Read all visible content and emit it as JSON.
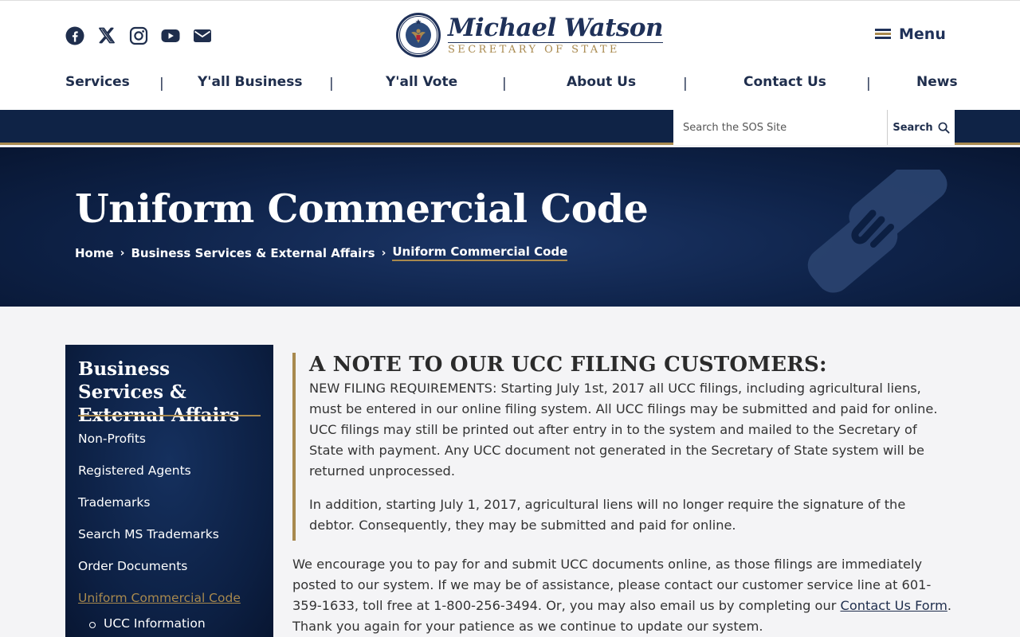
{
  "header": {
    "social_icons": [
      "facebook-icon",
      "x-twitter-icon",
      "instagram-icon",
      "youtube-icon",
      "email-icon"
    ],
    "logo_name": "Michael Watson",
    "logo_subtitle": "SECRETARY OF STATE",
    "menu_label": "Menu"
  },
  "nav": {
    "items": [
      "Services",
      "Y'all Business",
      "Y'all Vote",
      "About Us",
      "Contact Us",
      "News"
    ],
    "separator": "|"
  },
  "search": {
    "placeholder": "Search the SOS Site",
    "button_label": "Search"
  },
  "hero": {
    "title": "Uniform Commercial Code",
    "breadcrumbs": [
      "Home",
      "Business Services & External Affairs",
      "Uniform Commercial Code"
    ],
    "arrow": "›"
  },
  "sidebar": {
    "title": "Business Services & External Affairs",
    "items": [
      "Non-Profits",
      "Registered Agents",
      "Trademarks",
      "Search MS Trademarks",
      "Order Documents",
      "Uniform Commercial Code"
    ],
    "subitems": [
      "UCC Information"
    ]
  },
  "content": {
    "note_heading": "A NOTE TO OUR UCC FILING CUSTOMERS:",
    "note_p1": "NEW FILING REQUIREMENTS: Starting July 1st, 2017 all UCC filings, including agricultural liens, must be entered in our online filing system. All UCC filings may be submitted and paid for online. UCC filings may still be printed out after entry in to the system and mailed to the Secretary of State with payment. Any UCC document not generated in the Secretary of State system will be returned unprocessed.",
    "note_p2": "In addition, starting July 1, 2017, agricultural liens will no longer require the signature of the debtor. Consequently, they may be submitted and paid for online.",
    "body_before_link": "We encourage you to pay for and submit UCC documents online, as those filings are immediately posted to our system. If we may be of assistance, please contact our customer service line at 601-359-1633, toll free at 1-800-256-3494.  Or, you may also email us by completing our ",
    "body_link": "Contact Us Form",
    "body_after_link": ". Thank you again for your patience as we continue to update our system."
  },
  "colors": {
    "navy": "#0f2346",
    "gold": "#a8894e",
    "brand_text": "#1f3159"
  }
}
